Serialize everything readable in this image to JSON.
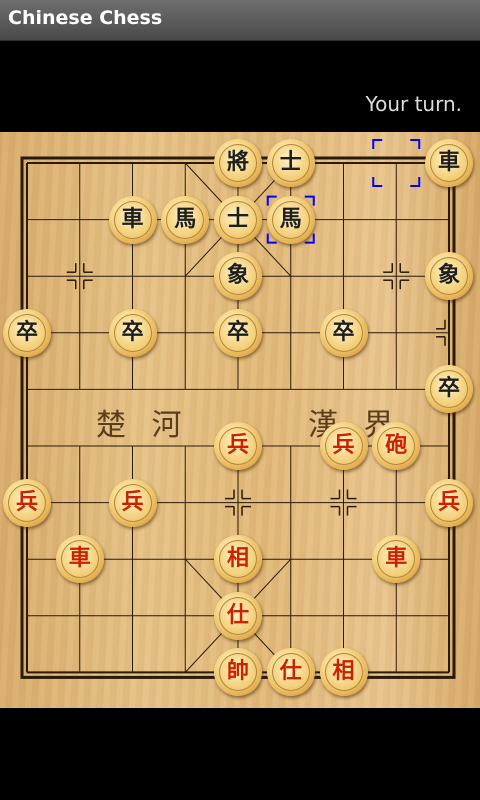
{
  "app_title": "Chinese Chess",
  "status_text": "Your turn.",
  "river": {
    "left": "楚 河",
    "right": "漢 界"
  },
  "colors": {
    "red_piece_text": "#cc2200",
    "black_piece_text": "#1e1e1e",
    "selection": "#0000ff"
  },
  "pieces": {
    "black": [
      {
        "label": "將",
        "file": 4,
        "rank": 0
      },
      {
        "label": "士",
        "file": 5,
        "rank": 0
      },
      {
        "label": "車",
        "file": 8,
        "rank": 0
      },
      {
        "label": "車",
        "file": 2,
        "rank": 1
      },
      {
        "label": "馬",
        "file": 3,
        "rank": 1
      },
      {
        "label": "士",
        "file": 4,
        "rank": 1
      },
      {
        "label": "馬",
        "file": 5,
        "rank": 1
      },
      {
        "label": "象",
        "file": 4,
        "rank": 2
      },
      {
        "label": "象",
        "file": 8,
        "rank": 2
      },
      {
        "label": "卒",
        "file": 0,
        "rank": 3
      },
      {
        "label": "卒",
        "file": 2,
        "rank": 3
      },
      {
        "label": "卒",
        "file": 4,
        "rank": 3
      },
      {
        "label": "卒",
        "file": 6,
        "rank": 3
      },
      {
        "label": "卒",
        "file": 8,
        "rank": 4
      }
    ],
    "red": [
      {
        "label": "兵",
        "file": 4,
        "rank": 5
      },
      {
        "label": "兵",
        "file": 6,
        "rank": 5
      },
      {
        "label": "砲",
        "file": 7,
        "rank": 5
      },
      {
        "label": "兵",
        "file": 0,
        "rank": 6
      },
      {
        "label": "兵",
        "file": 2,
        "rank": 6
      },
      {
        "label": "兵",
        "file": 8,
        "rank": 6
      },
      {
        "label": "車",
        "file": 1,
        "rank": 7
      },
      {
        "label": "相",
        "file": 4,
        "rank": 7
      },
      {
        "label": "車",
        "file": 7,
        "rank": 7
      },
      {
        "label": "仕",
        "file": 4,
        "rank": 8
      },
      {
        "label": "帥",
        "file": 4,
        "rank": 9
      },
      {
        "label": "仕",
        "file": 5,
        "rank": 9
      },
      {
        "label": "相",
        "file": 6,
        "rank": 9
      }
    ]
  },
  "selection_markers": [
    {
      "file": 7,
      "rank": 0
    },
    {
      "file": 5,
      "rank": 1
    }
  ]
}
